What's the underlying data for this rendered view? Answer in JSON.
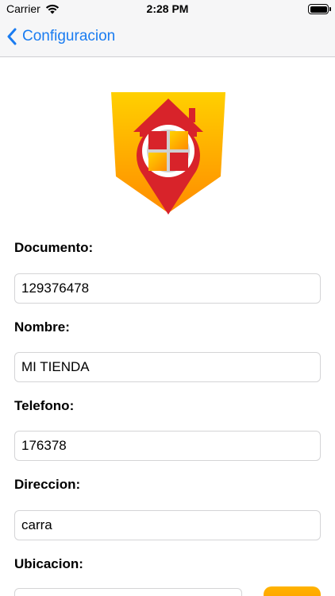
{
  "status_bar": {
    "carrier": "Carrier",
    "time": "2:28 PM"
  },
  "nav": {
    "back_label": "Configuracion"
  },
  "form": {
    "fields": [
      {
        "label": "Documento:",
        "value": "129376478"
      },
      {
        "label": "Nombre:",
        "value": "MI TIENDA"
      },
      {
        "label": "Telefono:",
        "value": "176378"
      },
      {
        "label": "Direccion:",
        "value": "carra"
      }
    ],
    "location_label": "Ubicacion:"
  },
  "colors": {
    "accent": "#1a7cf1",
    "logo_red": "#d8232a",
    "logo_orange": "#ff9f00",
    "logo_yellow": "#ffd200"
  }
}
